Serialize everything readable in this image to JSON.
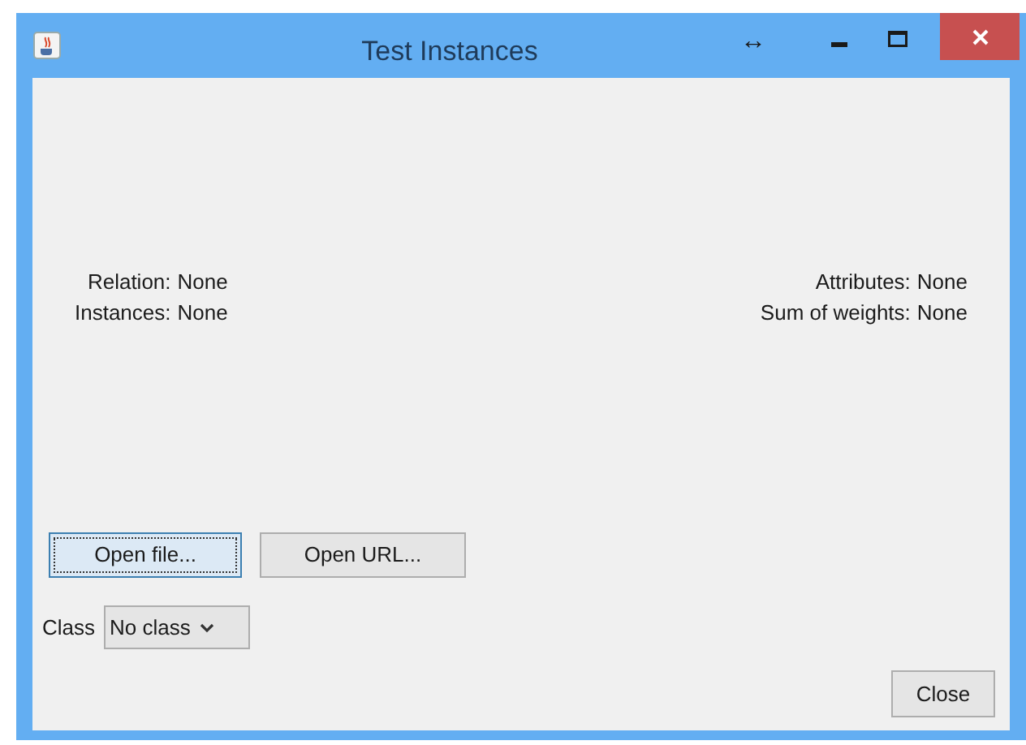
{
  "window": {
    "title": "Test Instances",
    "resize_glyph": "↔"
  },
  "summary_left": [
    {
      "label": "Relation:",
      "value": "None"
    },
    {
      "label": "Instances:",
      "value": "None"
    }
  ],
  "summary_right": [
    {
      "label": "Attributes:",
      "value": "None"
    },
    {
      "label": "Sum of weights:",
      "value": "None"
    }
  ],
  "open_buttons": [
    {
      "label": "Open file...",
      "focused": true
    },
    {
      "label": "Open URL...",
      "focused": false
    }
  ],
  "class_selector": {
    "label": "Class",
    "value": "No class"
  },
  "close_button": {
    "label": "Close"
  }
}
